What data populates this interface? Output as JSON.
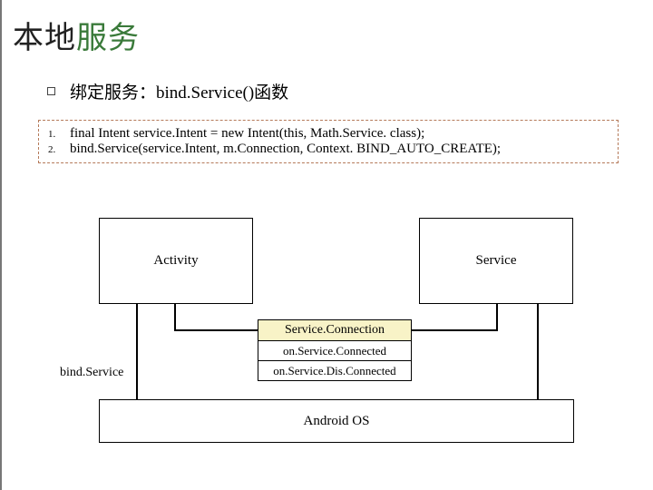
{
  "title_part1": "本地",
  "title_part2": "服务",
  "subtitle": "绑定服务：bind.Service()函数",
  "code": {
    "n1": "1.",
    "n2": "2.",
    "l1": "final Intent service.Intent = new Intent(this, Math.Service. class);",
    "l2": "bind.Service(service.Intent, m.Connection, Context. BIND_AUTO_CREATE);"
  },
  "diagram": {
    "activity": "Activity",
    "service": "Service",
    "svcconn": "Service.Connection",
    "on_connected": "on.Service.Connected",
    "on_disconnected": "on.Service.Dis.Connected",
    "android_os": "Android OS",
    "bind_label": "bind.Service"
  }
}
